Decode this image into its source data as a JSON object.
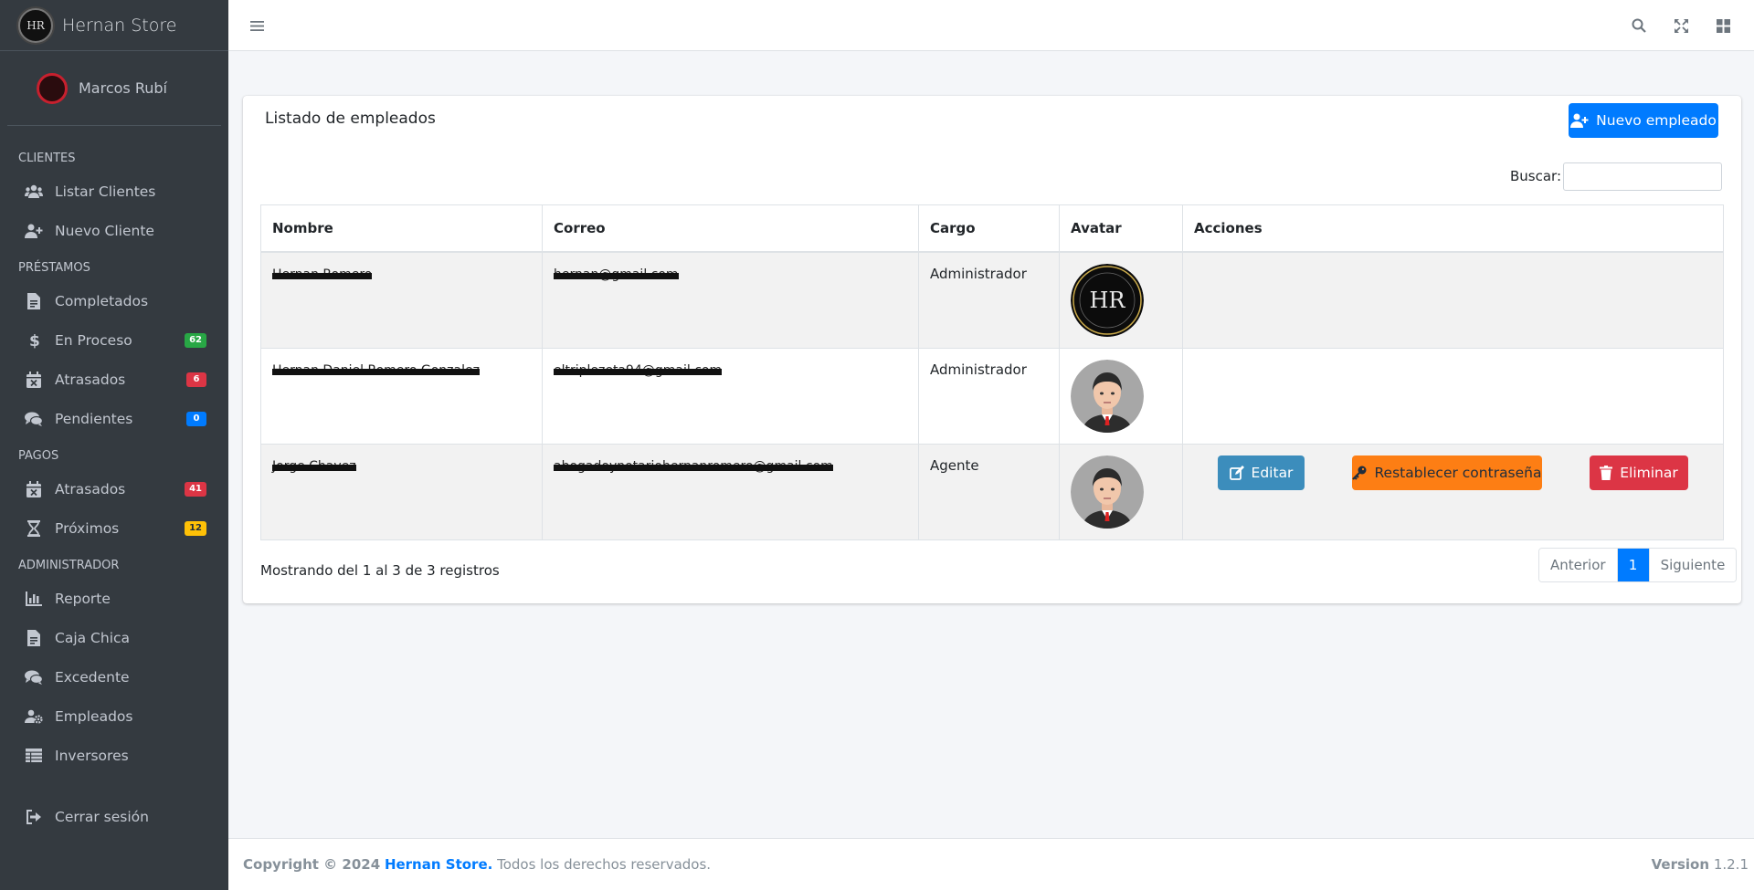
{
  "brand": {
    "name": "Hernan Store",
    "logo_text": "HR"
  },
  "user": {
    "name": "Marcos Rubí"
  },
  "sidebar": {
    "sections": [
      {
        "header": "CLIENTES",
        "items": [
          {
            "label": "Listar Clientes",
            "icon": "users-icon"
          },
          {
            "label": "Nuevo Cliente",
            "icon": "user-plus-icon"
          }
        ]
      },
      {
        "header": "PRÉSTAMOS",
        "items": [
          {
            "label": "Completados",
            "icon": "file-invoice-icon"
          },
          {
            "label": "En Proceso",
            "icon": "dollar-icon",
            "badge": "62",
            "badge_color": "#28a745"
          },
          {
            "label": "Atrasados",
            "icon": "calendar-x-icon",
            "badge": "6",
            "badge_color": "#dc3545"
          },
          {
            "label": "Pendientes",
            "icon": "comments-icon",
            "badge": "0",
            "badge_color": "#007bff"
          }
        ]
      },
      {
        "header": "PAGOS",
        "items": [
          {
            "label": "Atrasados",
            "icon": "calendar-x-icon",
            "badge": "41",
            "badge_color": "#dc3545"
          },
          {
            "label": "Próximos",
            "icon": "hourglass-icon",
            "badge": "12",
            "badge_color": "#ffc107"
          }
        ]
      },
      {
        "header": "ADMINISTRADOR",
        "items": [
          {
            "label": "Reporte",
            "icon": "chart-bar-icon"
          },
          {
            "label": "Caja Chica",
            "icon": "file-invoice-icon"
          },
          {
            "label": "Excedente",
            "icon": "comments-icon"
          },
          {
            "label": "Empleados",
            "icon": "users-cog-icon"
          },
          {
            "label": "Inversores",
            "icon": "table-list-icon"
          }
        ]
      }
    ],
    "logout_label": "Cerrar sesión"
  },
  "topbar": {
    "icons": [
      "menu-icon",
      "search-icon",
      "fullscreen-icon",
      "grid-icon"
    ]
  },
  "card": {
    "title": "Listado de empleados",
    "new_button_label": "Nuevo empleado",
    "search_label": "Buscar:",
    "search_value": "",
    "columns": [
      "Nombre",
      "Correo",
      "Cargo",
      "Avatar",
      "Acciones"
    ],
    "rows": [
      {
        "name": "Hernan Romero",
        "email": "hernan@gmail.com",
        "role": "Administrador",
        "avatar": "logo-avatar",
        "actions": false
      },
      {
        "name": "Hernan Daniel Romero Gonzalez",
        "email": "eltriplezeta94@gmail.com",
        "role": "Administrador",
        "avatar": "person-avatar",
        "actions": false
      },
      {
        "name": "Jorge Chavez",
        "email": "abogadoynotariohernanromero@gmail.com",
        "role": "Agente",
        "avatar": "person-avatar",
        "actions": true
      }
    ],
    "actions": {
      "edit": "Editar",
      "reset": "Restablecer contraseña",
      "delete": "Eliminar"
    },
    "info": "Mostrando del 1 al 3 de 3 registros",
    "pagination": {
      "prev": "Anterior",
      "current": "1",
      "next": "Siguiente"
    }
  },
  "footer": {
    "copyright_prefix": "Copyright © 2024",
    "brand_link": "Hernan Store.",
    "rights": "Todos los derechos reservados.",
    "version_label": "Version",
    "version": "1.2.1"
  },
  "colors": {
    "sidebar_bg": "#343a40",
    "primary": "#007bff",
    "info": "#3c8dbc",
    "warning": "#fd7e14",
    "danger": "#dc3545"
  }
}
